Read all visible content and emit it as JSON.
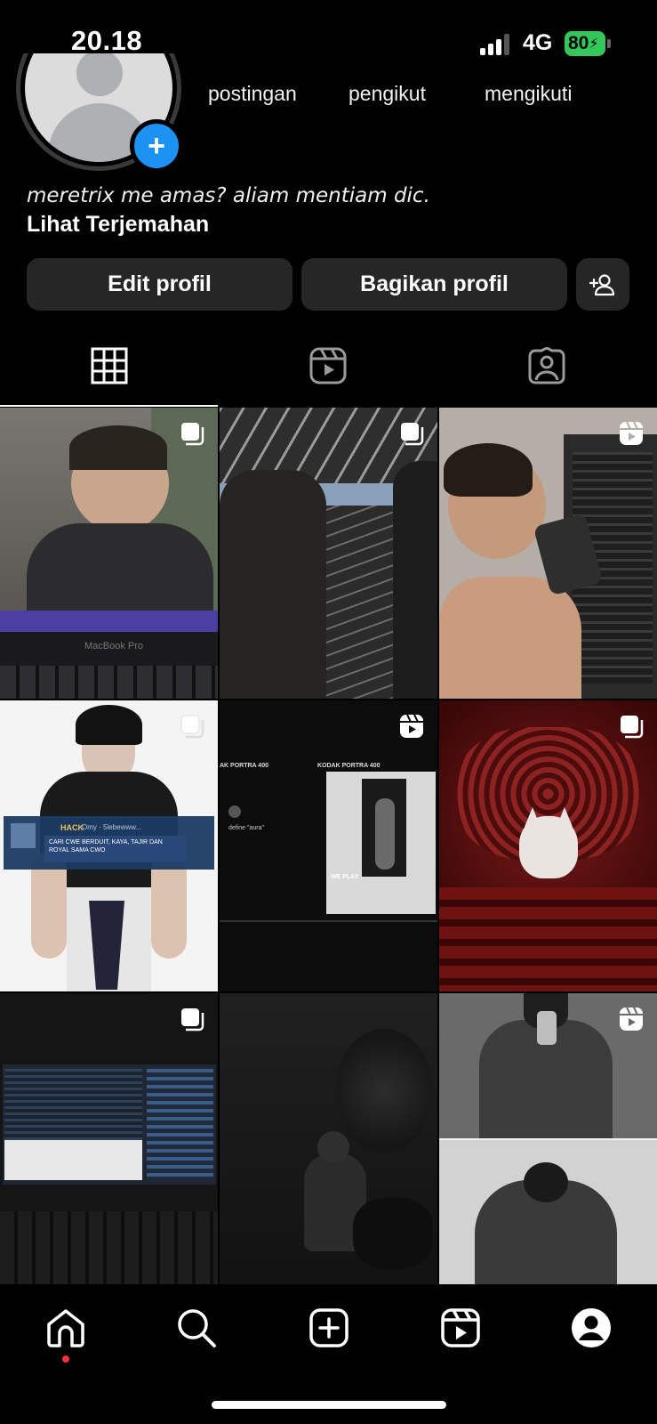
{
  "status_bar": {
    "time": "20.18",
    "network": "4G",
    "battery": "80"
  },
  "profile": {
    "stats": {
      "posts_label": "postingan",
      "followers_label": "pengikut",
      "following_label": "mengikuti"
    },
    "bio": "meretrix me amas? aliam mentiam dic.",
    "translate_link": "Lihat Terjemahan"
  },
  "actions": {
    "edit_profile": "Edit profil",
    "share_profile": "Bagikan profil"
  },
  "tabs": [
    {
      "icon": "grid-icon",
      "active": true
    },
    {
      "icon": "reels-icon",
      "active": false
    },
    {
      "icon": "tagged-icon",
      "active": false
    }
  ],
  "grid": [
    {
      "type": "carousel",
      "tone": "#6d6a66",
      "accent": "#4b3fa3"
    },
    {
      "type": "carousel",
      "tone": "#4a4a4a",
      "accent": "#8aa0b8"
    },
    {
      "type": "reel",
      "tone": "#8c8680",
      "accent": "#c9b8a6"
    },
    {
      "type": "carousel",
      "tone": "#e8e8e8",
      "accent": "#1b3a63"
    },
    {
      "type": "reel",
      "tone": "#0c0c0c",
      "accent": "#d9d9d9"
    },
    {
      "type": "carousel",
      "tone": "#5a1212",
      "accent": "#e9e4e0"
    },
    {
      "type": "carousel",
      "tone": "#151515",
      "accent": "#3b5c8a"
    },
    {
      "type": "none",
      "tone": "#1a1a1a",
      "accent": "#2e2e2e"
    },
    {
      "type": "reel",
      "tone": "#5e5e5e",
      "accent": "#bdbdbd"
    }
  ],
  "post_texts": {
    "macbook_label": "MacBook Pro",
    "hack_name": "HACK",
    "hack_meta": "Omy · 5lebewww...",
    "hack_message": "CARI CWE BERDUIT, KAYA, TAJIR DAN ROYAL SAMA CWO",
    "kodak_left": "AK PORTRA 400",
    "kodak_right": "KODAK PORTRA 400",
    "tweet_text": "define \"aura\"",
    "tweet_watermark": "WE PLAY"
  },
  "bottom_nav": [
    {
      "icon": "home-icon",
      "active": true
    },
    {
      "icon": "search-icon"
    },
    {
      "icon": "create-post-icon"
    },
    {
      "icon": "reels-icon"
    },
    {
      "icon": "profile-icon"
    }
  ],
  "colors": {
    "background": "#000000",
    "button_bg": "#262626",
    "accent_blue": "#1c93f3",
    "battery_green": "#34c759",
    "notification_red": "#ff3040"
  }
}
